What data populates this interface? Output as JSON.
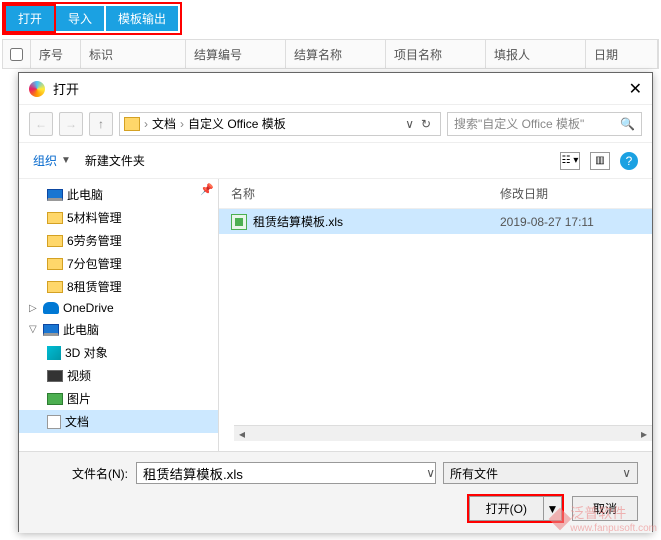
{
  "toolbar": {
    "open": "打开",
    "import": "导入",
    "template": "模板输出"
  },
  "grid": {
    "seq": "序号",
    "id": "标识",
    "code": "结算编号",
    "name": "结算名称",
    "proj": "项目名称",
    "filler": "填报人",
    "date": "日期"
  },
  "dialog": {
    "title": "打开",
    "path": {
      "p1": "文档",
      "p2": "自定义 Office 模板"
    },
    "search_placeholder": "搜索\"自定义 Office 模板\"",
    "organize": "组织",
    "new_folder": "新建文件夹",
    "col_name": "名称",
    "col_date": "修改日期"
  },
  "tree": {
    "thispc1": "此电脑",
    "f5": "5材料管理",
    "f6": "6劳务管理",
    "f7": "7分包管理",
    "f8": "8租赁管理",
    "onedrive": "OneDrive",
    "thispc2": "此电脑",
    "obj3d": "3D 对象",
    "video": "视频",
    "picture": "图片",
    "doc": "文档"
  },
  "file": {
    "name": "租赁结算模板.xls",
    "date": "2019-08-27 17:11"
  },
  "footer": {
    "filename_label": "文件名(N):",
    "filename_value": "租赁结算模板.xls",
    "filetype": "所有文件",
    "open": "打开(O)",
    "cancel": "取消"
  },
  "watermark": {
    "brand": "泛普软件",
    "url": "www.fanpusoft.com"
  }
}
